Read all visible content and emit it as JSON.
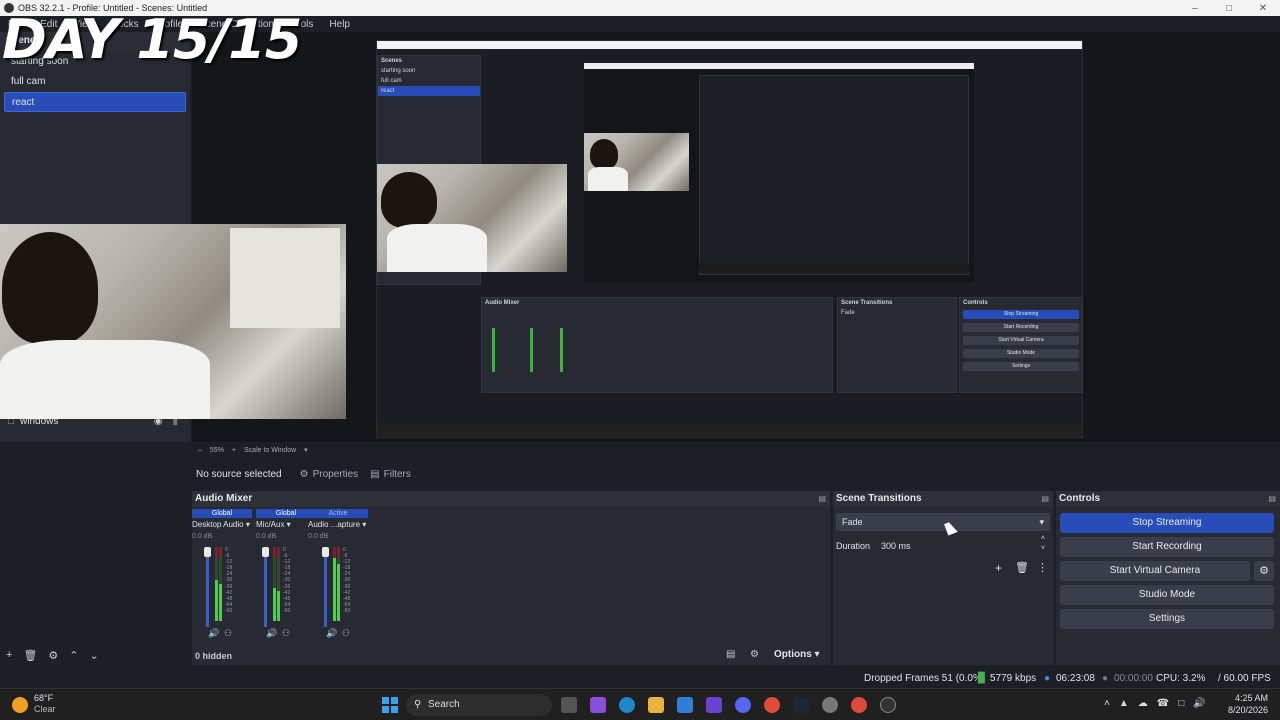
{
  "window": {
    "title": "OBS 32.2.1 - Profile: Untitled - Scenes: Untitled"
  },
  "overlay": {
    "text": "DAY 15/15"
  },
  "menu": [
    "File",
    "Edit",
    "View",
    "Docks",
    "Profile",
    "Scene Collection",
    "Tools",
    "Help"
  ],
  "scenes": {
    "header": "Scenes",
    "items": [
      {
        "label": "starting soon"
      },
      {
        "label": "full cam"
      },
      {
        "label": "react",
        "active": true
      }
    ]
  },
  "sources": {
    "items": [
      {
        "label": "windows"
      }
    ]
  },
  "preview": {
    "zoom": "55%",
    "scale_mode": "Scale to Window"
  },
  "properties_bar": {
    "no_source": "No source selected",
    "properties_label": "Properties",
    "filters_label": "Filters"
  },
  "audio_mixer": {
    "title": "Audio Mixer",
    "channels": [
      {
        "tag": "Global",
        "name": "Desktop Audio",
        "db": "0.0 dB",
        "level": 0.55
      },
      {
        "tag": "Global",
        "name": "Mic/Aux",
        "db": "0.0 dB",
        "level": 0.45
      },
      {
        "tag": "Active",
        "name": "Audio ...apture",
        "db": "0.0 dB",
        "level": 0.85
      }
    ],
    "scale": [
      "0",
      "-6",
      "-12",
      "-18",
      "-24",
      "-30",
      "-36",
      "-42",
      "-48",
      "-54",
      "-60"
    ],
    "hidden": "0 hidden",
    "options": "Options"
  },
  "scene_transitions": {
    "title": "Scene Transitions",
    "transition": "Fade",
    "duration_label": "Duration",
    "duration_value": "300 ms"
  },
  "controls": {
    "title": "Controls",
    "stop_streaming": "Stop Streaming",
    "start_recording": "Start Recording",
    "start_virtual_camera": "Start Virtual Camera",
    "studio_mode": "Studio Mode",
    "settings": "Settings"
  },
  "status": {
    "dropped_frames": "Dropped Frames 51 (0.0%)",
    "bitrate": "5779 kbps",
    "stream_time": "06:23:08",
    "record_time": "00:00:00",
    "cpu": "CPU: 3.2%",
    "fps": "/ 60.00 FPS"
  },
  "taskbar": {
    "weather_temp": "68°F",
    "weather_desc": "Clear",
    "search": "Search",
    "time": "4:25 AM",
    "date": "8/20/2026"
  },
  "colors": {
    "accent": "#284cb8",
    "panel": "#272a33",
    "background": "#1d1f26"
  }
}
